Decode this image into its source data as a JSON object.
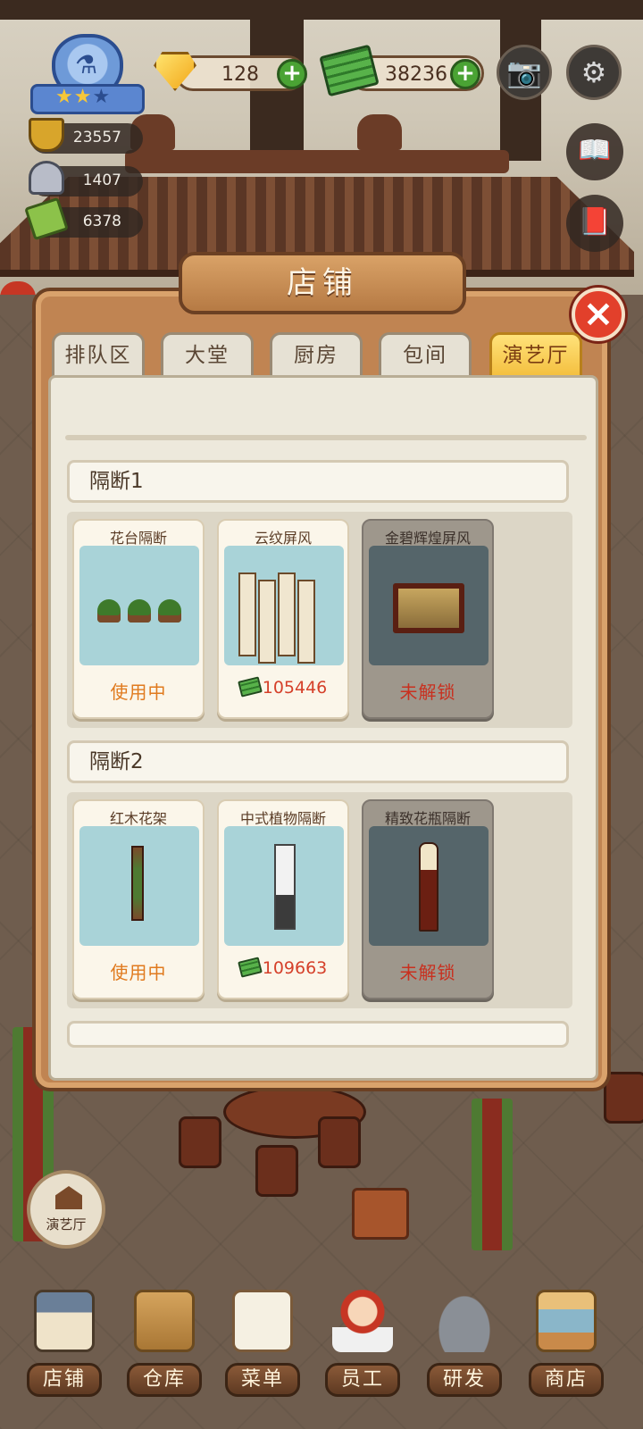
{
  "hud": {
    "gems": "128",
    "cash": "38236",
    "stats": {
      "reputation": "23557",
      "dishes": "1407",
      "recipes": "6378"
    }
  },
  "panel": {
    "title": "店铺",
    "close": "×",
    "tabs": [
      "排队区",
      "大堂",
      "厨房",
      "包间",
      "演艺厅"
    ],
    "active_tab": "演艺厅",
    "sections": [
      {
        "title": "隔断1",
        "items": [
          {
            "name": "花台隔断",
            "status": "使用中"
          },
          {
            "name": "云纹屏风",
            "price": "105446"
          },
          {
            "name": "金碧辉煌屏风",
            "status": "未解锁"
          }
        ]
      },
      {
        "title": "隔断2",
        "items": [
          {
            "name": "红木花架",
            "status": "使用中"
          },
          {
            "name": "中式植物隔断",
            "price": "109663"
          },
          {
            "name": "精致花瓶隔断",
            "status": "未解锁"
          }
        ]
      }
    ]
  },
  "floating": {
    "theater_label": "演艺厅"
  },
  "nav": {
    "items": [
      "店铺",
      "仓库",
      "菜单",
      "员工",
      "研发",
      "商店"
    ]
  },
  "colors": {
    "in_use": "#e07a1e",
    "locked": "#c8301f",
    "price": "#d5402a",
    "active_tab": "#f3bd3b",
    "close": "#e2402b"
  }
}
